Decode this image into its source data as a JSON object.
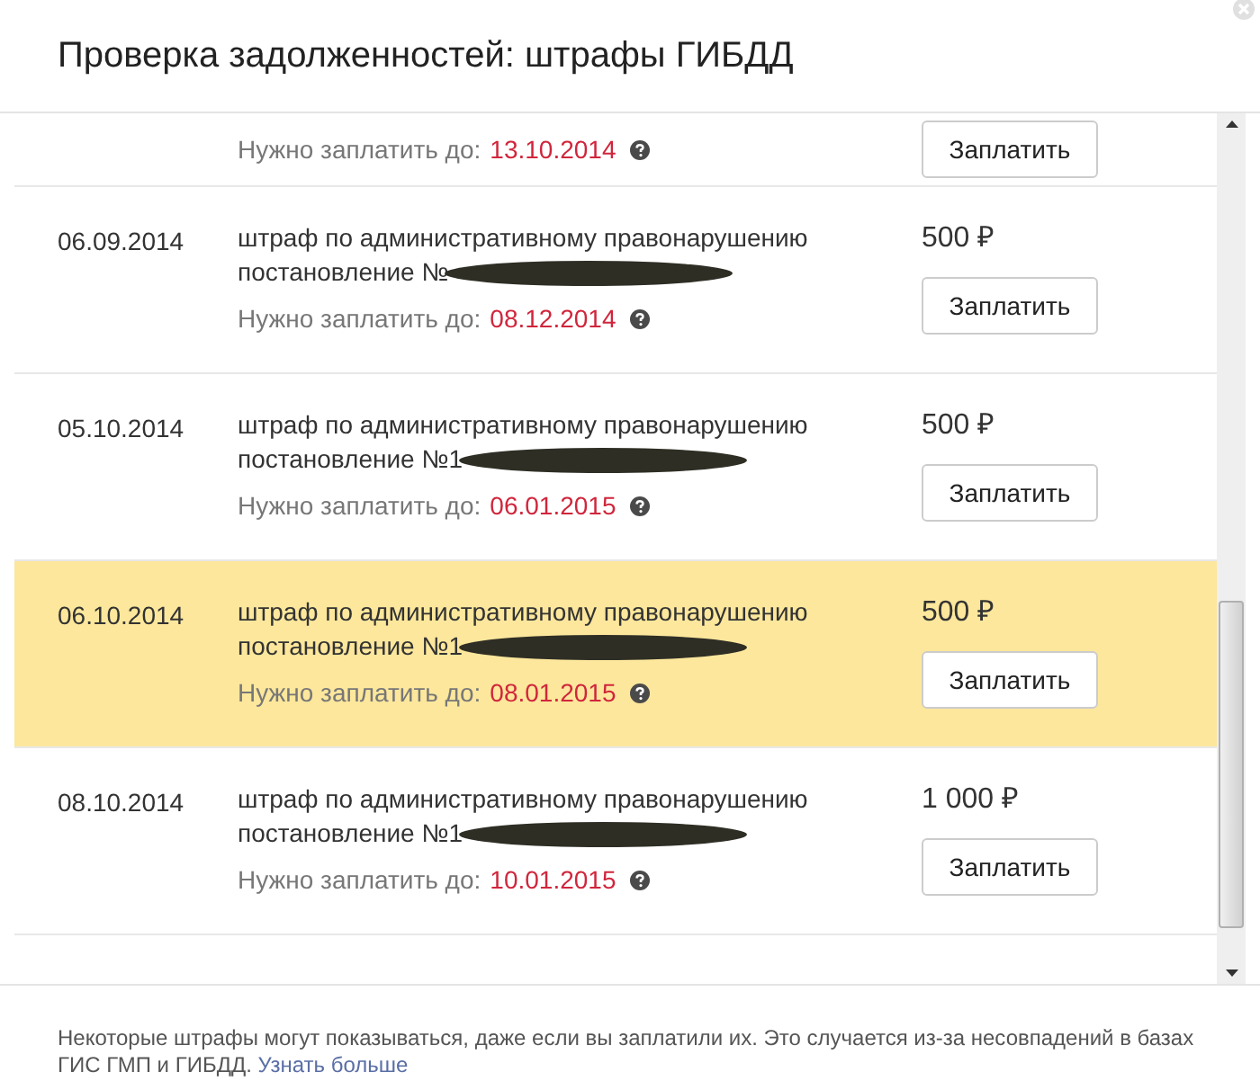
{
  "title": "Проверка задолженностей: штрафы ГИБДД",
  "fines": [
    {
      "due_label": "Нужно заплатить до:",
      "due_date": "13.10.2014",
      "button": "Заплатить",
      "selected": false
    },
    {
      "date": "06.09.2014",
      "description": "штраф по административному правонарушению",
      "resolution": "постановление №",
      "amount": "500 ₽",
      "due_label": "Нужно заплатить до:",
      "due_date": "08.12.2014",
      "button": "Заплатить",
      "selected": false
    },
    {
      "date": "05.10.2014",
      "description": "штраф по административному правонарушению",
      "resolution": "постановление №1",
      "amount": "500 ₽",
      "due_label": "Нужно заплатить до:",
      "due_date": "06.01.2015",
      "button": "Заплатить",
      "selected": false
    },
    {
      "date": "06.10.2014",
      "description": "штраф по административному правонарушению",
      "resolution": "постановление №1",
      "amount": "500 ₽",
      "due_label": "Нужно заплатить до:",
      "due_date": "08.01.2015",
      "button": "Заплатить",
      "selected": true
    },
    {
      "date": "08.10.2014",
      "description": "штраф по административному правонарушению",
      "resolution": "постановление №1",
      "amount": "1 000 ₽",
      "due_label": "Нужно заплатить до:",
      "due_date": "10.01.2015",
      "button": "Заплатить",
      "selected": false
    }
  ],
  "notice": {
    "text": "Некоторые штрафы могут показываться, даже если вы заплатили их. Это случается из-за несовпадений в базах ГИС ГМП и ГИБДД.",
    "link": "Узнать больше"
  }
}
